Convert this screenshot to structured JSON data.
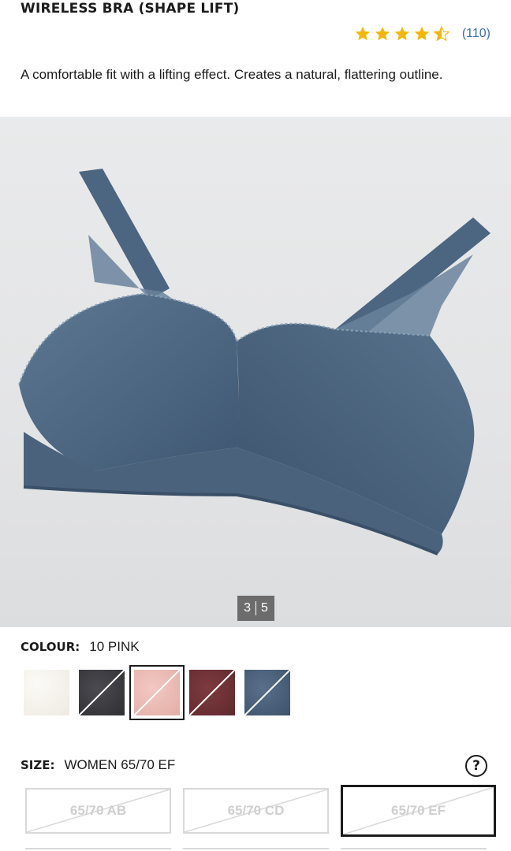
{
  "product": {
    "title": "WIRELESS BRA (SHAPE LIFT)",
    "rating": 4.5,
    "reviews": "(110)",
    "description": "A comfortable fit with a lifting effect. Creates a natural, flattering outline."
  },
  "gallery": {
    "current": "3",
    "total": "5"
  },
  "colour": {
    "label": "COLOUR:",
    "selected": "10 PINK",
    "swatches": [
      {
        "name": "off-white",
        "color": "#f3f0ea",
        "available": true
      },
      {
        "name": "dark-grey",
        "color": "#3d3d42",
        "available": false
      },
      {
        "name": "pink",
        "color": "#ecbcb5",
        "available": false,
        "selected": true
      },
      {
        "name": "wine",
        "color": "#6f3236",
        "available": false
      },
      {
        "name": "blue",
        "color": "#4a5f78",
        "available": false
      }
    ]
  },
  "size": {
    "label": "SIZE:",
    "selected": "WOMEN 65/70 EF",
    "help_icon": "question-circle-icon",
    "options": [
      {
        "label": "65/70 AB",
        "available": false
      },
      {
        "label": "65/70 CD",
        "available": false
      },
      {
        "label": "65/70 EF",
        "available": false,
        "selected": true
      }
    ]
  },
  "colors": {
    "star": "#f2b705",
    "link": "#3a6fb0",
    "bra": "#4c6580"
  }
}
